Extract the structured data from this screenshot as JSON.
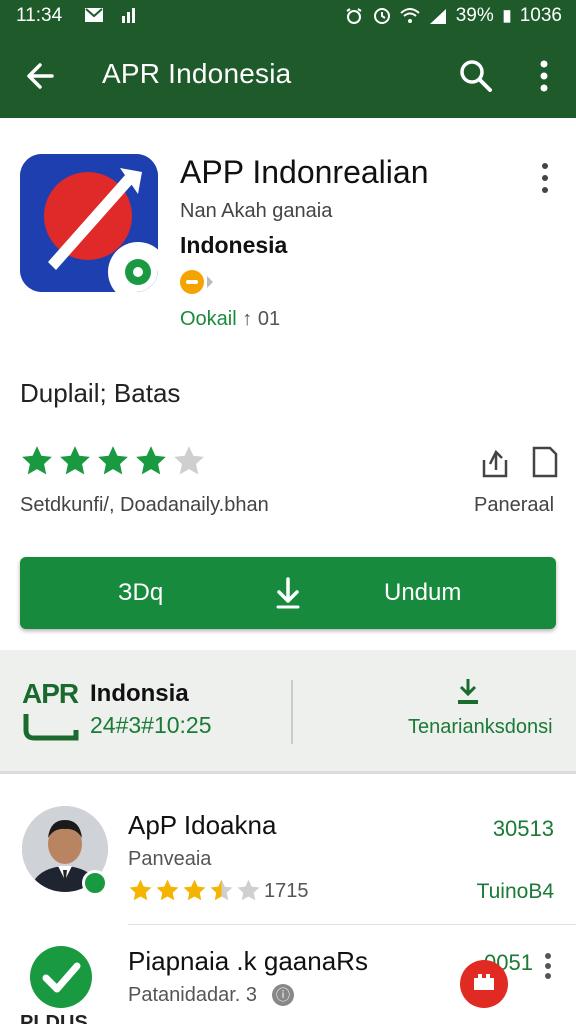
{
  "status_bar": {
    "time": "11:34",
    "battery": "39%",
    "extra": "1036",
    "icons": [
      "mail-icon",
      "signal-bars-icon",
      "alarm-icon",
      "clock-icon",
      "wifi-icon",
      "cell-signal-icon"
    ]
  },
  "app_bar": {
    "title": "APR Indonesia",
    "icons": [
      "back-arrow-icon",
      "search-icon",
      "more-vert-icon"
    ]
  },
  "app": {
    "name": "APP Indonrealian",
    "developer": "Nan Akah ganaia",
    "category": "Indonesia",
    "installs_label": "Ookail",
    "installs_value": "↑ 01"
  },
  "section": {
    "title": "Duplail; Batas"
  },
  "rating": {
    "stars": 4,
    "max_stars": 5,
    "caption": "Setdkunfi/, Doadanaily.bhan",
    "panel_label": "Paneraal"
  },
  "install_button": {
    "left_label": "ЗDq",
    "right_label": "Undum"
  },
  "promo_band": {
    "brand": "APR",
    "title": "Indonsia",
    "code": "24#3#10:25",
    "right_label": "Tenarianksdonsi"
  },
  "list": [
    {
      "title": "ApP Idoakna",
      "subtitle": "Panveaia",
      "stars": 3.5,
      "count": "1715",
      "right_top": "30513",
      "right_bottom": "TuinoB4"
    },
    {
      "title": "Piapnaia .k gaanaRs",
      "subtitle": "Patanidadar. 3",
      "right_top": "0051",
      "left_label": "PLDUS"
    }
  ],
  "colors": {
    "primary_dark": "#1e5a2a",
    "accent_green": "#178a3e",
    "star_green": "#1a9a40",
    "star_gold": "#f4b400"
  }
}
